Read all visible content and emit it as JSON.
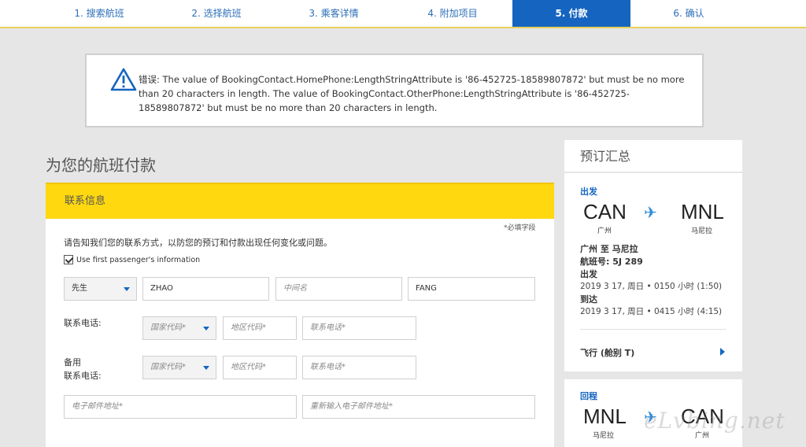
{
  "steps": [
    {
      "label": "1. 搜索航班"
    },
    {
      "label": "2. 选择航班"
    },
    {
      "label": "3. 乘客详情"
    },
    {
      "label": "4. 附加项目"
    },
    {
      "label": "5. 付款",
      "active": true
    },
    {
      "label": "6. 确认"
    }
  ],
  "error": {
    "icon": "warning-triangle-icon",
    "message": "错误: The value of BookingContact.HomePhone:LengthStringAttribute is '86-452725-18589807872' but must be no more than 20 characters in length. The value of BookingContact.OtherPhone:LengthStringAttribute is '86-452725-18589807872' but must be no more than 20 characters in length."
  },
  "page": {
    "title": "为您的航班付款"
  },
  "contact": {
    "heading": "联系信息",
    "required_note": "*必填字段",
    "description": "请告知我们您的联系方式，以防您的预订和付款出现任何变化或问题。",
    "use_first_passenger": "Use first passenger's information",
    "title_value": "先生",
    "first_name": "ZHAO",
    "middle_name_placeholder": "中间名",
    "last_name": "FANG",
    "phone_label": "联系电话:",
    "alt_phone_label_line1": "备用",
    "alt_phone_label_line2": "联系电话:",
    "country_code_placeholder": "国家代码*",
    "area_code_placeholder": "地区代码*",
    "phone_placeholder": "联系电话*",
    "email_placeholder": "电子邮件地址*",
    "email_confirm_placeholder": "重新输入电子邮件地址*"
  },
  "summary": {
    "heading": "预订汇总",
    "outbound": {
      "label": "出发",
      "from_code": "CAN",
      "from_city": "广州",
      "to_code": "MNL",
      "to_city": "马尼拉",
      "route": "广州 至 马尼拉",
      "flight_no": "航班号: 5J 289",
      "depart_label": "出发",
      "depart_time": "2019 3 17, 周日 • 0150 小时 (1:50)",
      "arrive_label": "到达",
      "arrive_time": "2019 3 17, 周日 • 0415 小时 (4:15)",
      "fare_link": "飞行 (舱别 T)"
    },
    "return": {
      "label": "回程",
      "from_code": "MNL",
      "from_city": "马尼拉",
      "to_code": "CAN",
      "to_city": "广州"
    }
  },
  "colors": {
    "accent": "#1565c0",
    "header_yellow": "#ffd80f"
  },
  "watermark": "eLvbing.net"
}
